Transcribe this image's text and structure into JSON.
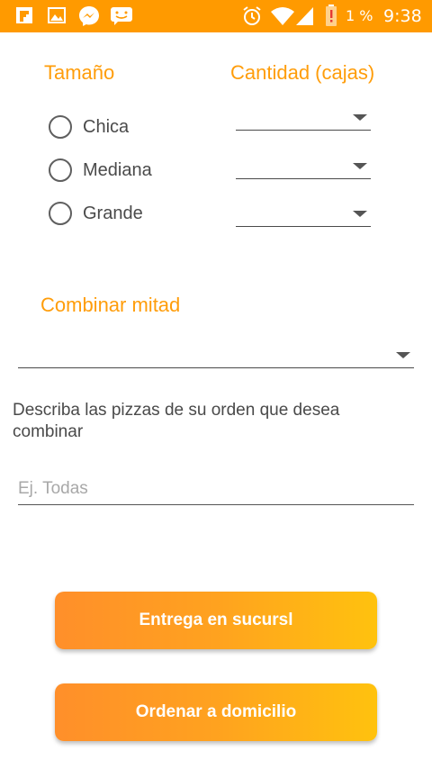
{
  "status_bar": {
    "battery": "1 %",
    "time": "9:38",
    "bg_color": "#ff9a00",
    "left_icons": [
      "flipboard-icon",
      "gallery-icon",
      "messenger-icon",
      "chat-icon"
    ],
    "right_icons": [
      "alarm-icon",
      "wifi-icon",
      "signal-icon",
      "battery-alert-icon"
    ]
  },
  "form": {
    "size_header": "Tamaño",
    "quantity_header": "Cantidad (cajas)",
    "sizes": [
      {
        "label": "Chica"
      },
      {
        "label": "Mediana"
      },
      {
        "label": "Grande"
      }
    ],
    "combine_header": "Combinar mitad",
    "describe_text": "Describa las pizzas de su orden que desea combinar",
    "describe_placeholder": "Ej. Todas"
  },
  "buttons": {
    "pickup_label": "Entrega en sucursl",
    "delivery_label": "Ordenar a domicilio"
  },
  "colors": {
    "accent": "#ff9d0a",
    "button_gradient_start": "#ff8f2a",
    "button_gradient_end": "#ffc20e"
  }
}
